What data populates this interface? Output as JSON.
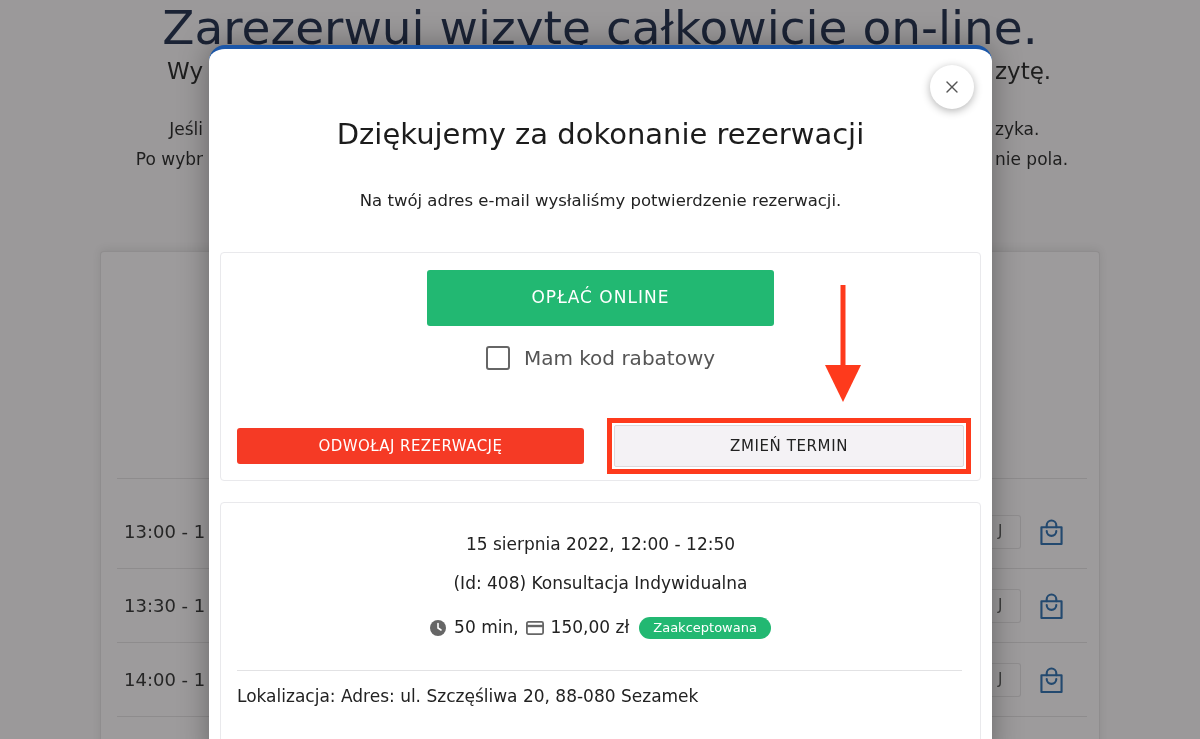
{
  "background": {
    "heading": "Zarezerwuj wizytę całkowicie on-line.",
    "intro_lines": [
      {
        "left": "Wy",
        "right": "zytę."
      },
      {
        "left": "Jeśli",
        "right": "zyka."
      },
      {
        "left": "Po wybr",
        "right": "nie pola."
      }
    ],
    "slots": [
      {
        "time": "13:00 - 1",
        "button_fragment": "J"
      },
      {
        "time": "13:30 - 1",
        "button_fragment": "J"
      },
      {
        "time": "14:00 - 1",
        "button_fragment": "J"
      }
    ]
  },
  "dialog": {
    "title": "Dziękujemy za dokonanie rezerwacji",
    "message": "Na twój adres e-mail wysłaliśmy potwierdzenie rezerwacji.",
    "pay_button": "OPŁAĆ ONLINE",
    "discount_checkbox": {
      "label": "Mam kod rabatowy",
      "checked": false
    },
    "cancel_button": "ODWOŁAJ REZERWACJĘ",
    "reschedule_button": {
      "label": "ZMIEŃ TERMIN",
      "highlighted": true
    },
    "booking": {
      "date": "15 sierpnia 2022, 12:00 - 12:50",
      "service": "(Id: 408) Konsultacja Indywidualna",
      "duration": "50 min,",
      "price": "150,00 zł",
      "status": "Zaakceptowana",
      "location": "Lokalizacja: Adres: ul. Szczęśliwa 20, 88-080 Sezamek"
    }
  }
}
